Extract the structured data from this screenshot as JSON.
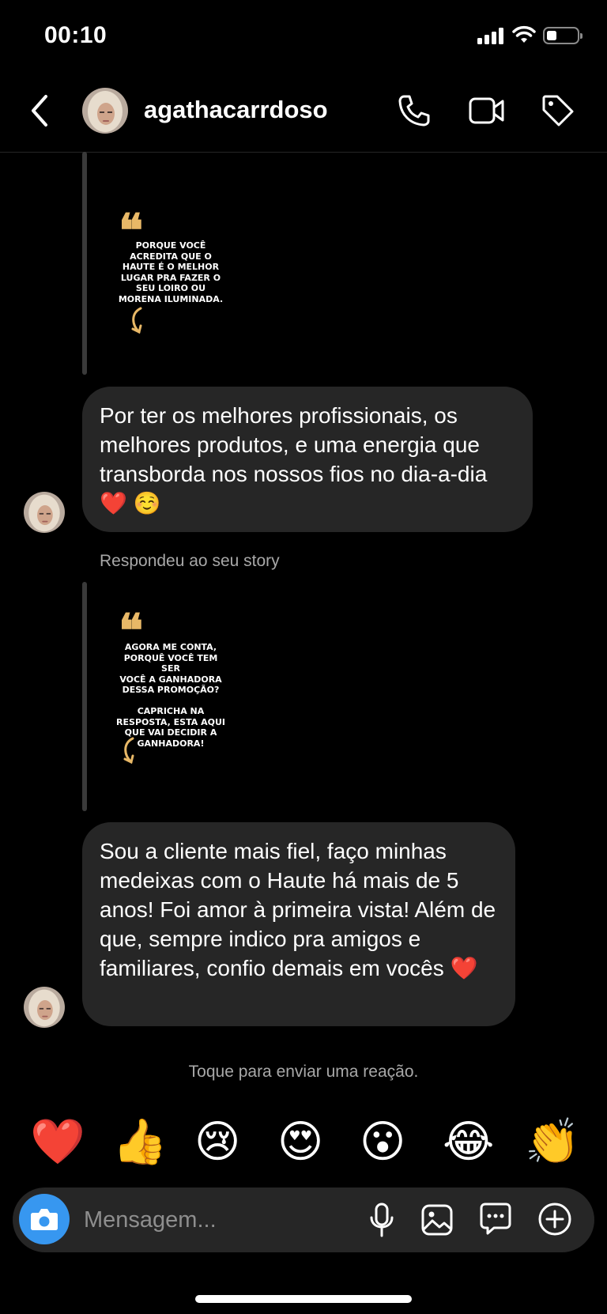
{
  "status_bar": {
    "time": "00:10"
  },
  "header": {
    "username": "agathacarrdoso"
  },
  "thread": {
    "story_1": {
      "quote_mark": "❝",
      "text": "PORQUE VOCÊ\nACREDITA QUE O\nHAUTE É O MELHOR\nLUGAR PRA FAZER O\nSEU LOIRO OU\nMORENA ILUMINADA."
    },
    "message_1": "Por ter os melhores profissionais, os melhores produtos, e uma energia que transborda nos nossos fios no dia-a-dia ❤️ ☺️",
    "replied_label": "Respondeu ao seu story",
    "story_2": {
      "quote_mark": "❝",
      "text": "AGORA ME CONTA,\nPORQUÊ VOCÊ TEM SER\nVOCÊ A GANHADORA\nDESSA PROMOÇÃO?\n\nCAPRICHA NA\nRESPOSTA, ESTA AQUI\nQUE VAI DECIDIR A\nGANHADORA!"
    },
    "message_2": "Sou a cliente mais fiel, faço minhas medeixas com o Haute há mais de 5 anos! Foi amor à primeira vista! Além de que, sempre indico pra amigos e familiares, confio demais em vocês ❤️",
    "reaction_hint": "Toque para enviar uma reação."
  },
  "reactions": [
    "❤️",
    "👍",
    "😢",
    "😍",
    "😮",
    "😂",
    "👏"
  ],
  "composer": {
    "placeholder": "Mensagem..."
  },
  "colors": {
    "accent": "#3797f0",
    "bubble": "#262626",
    "quote": "#e8b867"
  }
}
